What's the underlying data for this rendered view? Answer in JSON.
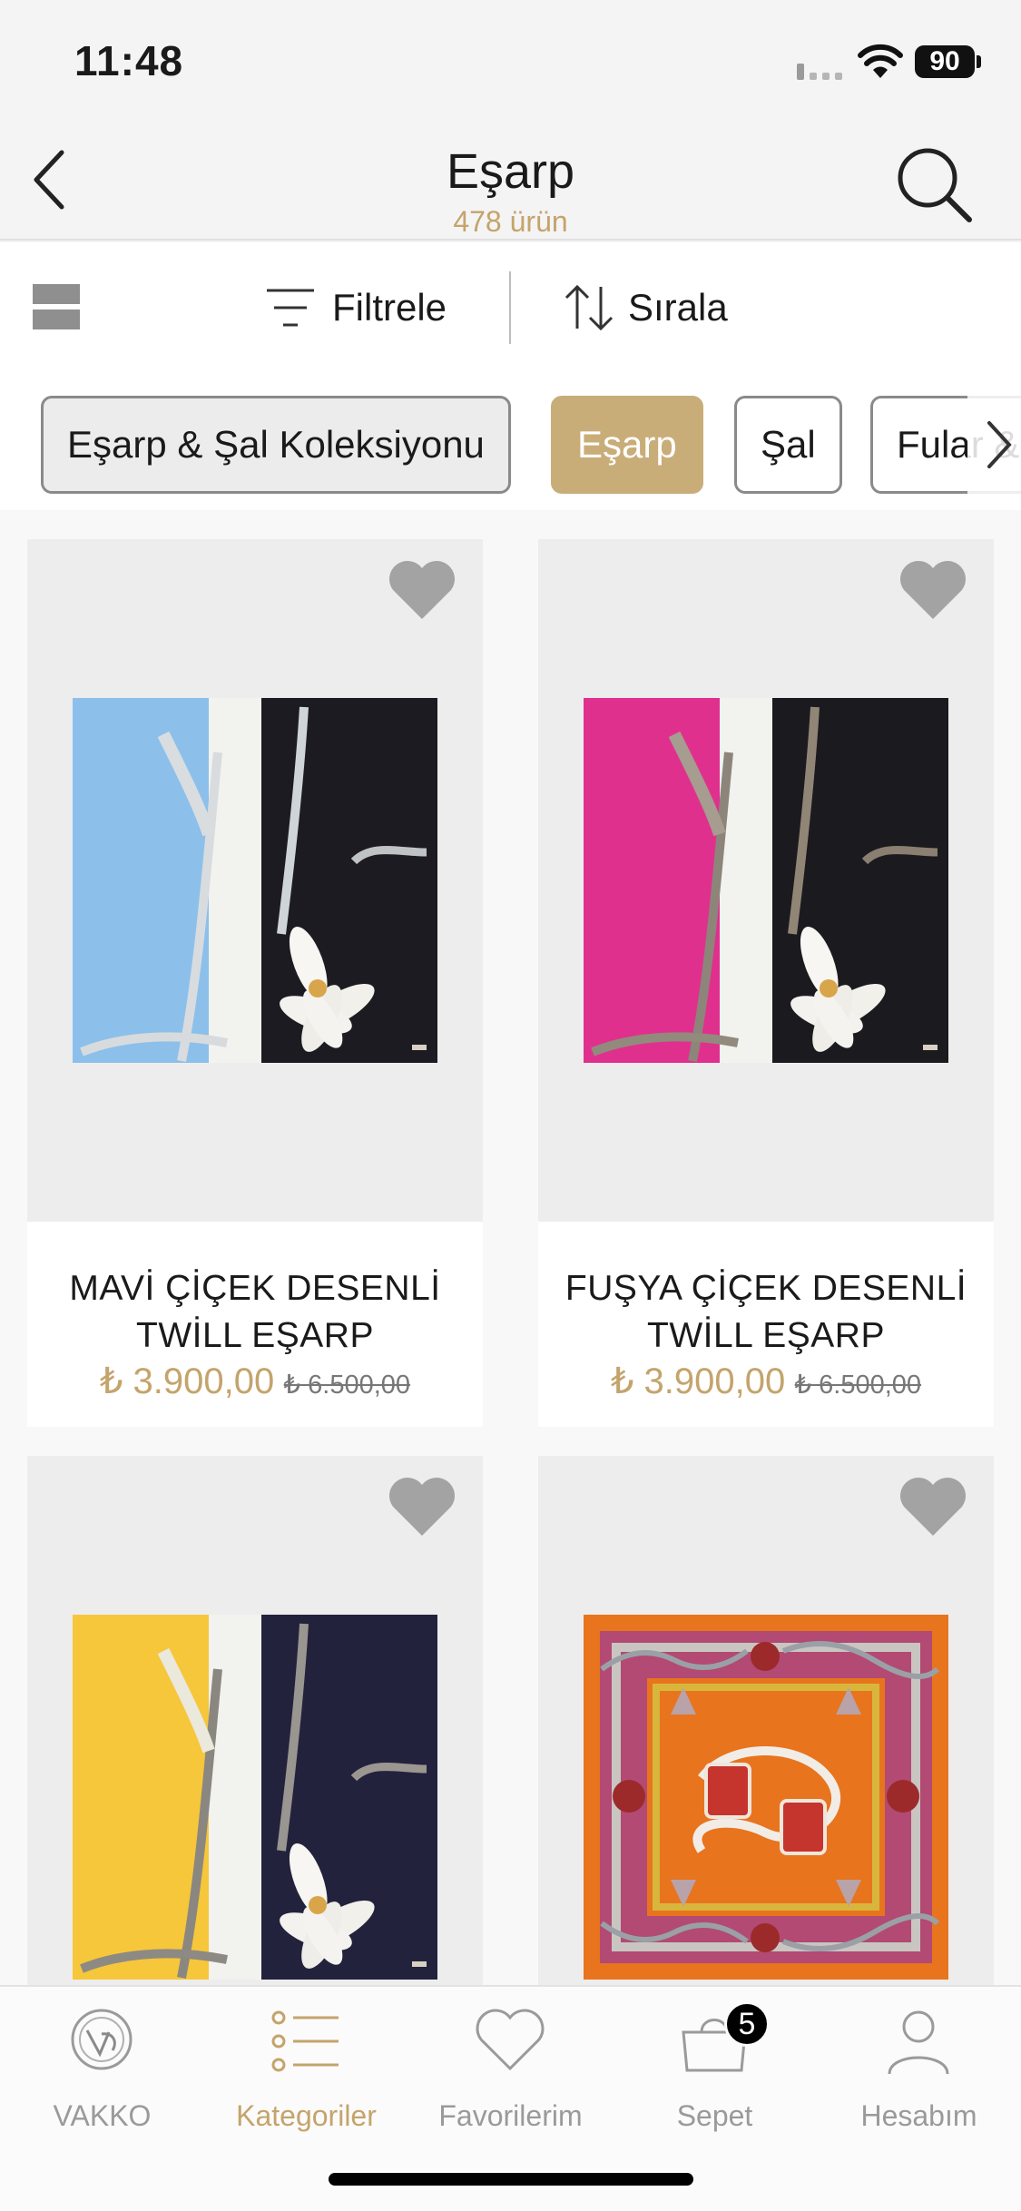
{
  "status": {
    "time": "11:48",
    "battery": "90"
  },
  "header": {
    "title": "Eşarp",
    "count": "478 ürün"
  },
  "toolbar": {
    "filter_label": "Filtrele",
    "sort_label": "Sırala"
  },
  "chips": [
    {
      "label": "Eşarp & Şal Koleksiyonu",
      "state": "secondary"
    },
    {
      "label": "Eşarp",
      "state": "active"
    },
    {
      "label": "Şal",
      "state": "default"
    },
    {
      "label": "Fular & ",
      "state": "default"
    }
  ],
  "products": [
    {
      "title_line1": "MAVİ ÇİÇEK DESENLİ",
      "title_line2": "TWİLL EŞARP",
      "price": "₺ 3.900,00",
      "old_price": "₺ 6.500,00",
      "colors": [
        "#8cc0ea",
        "#1c1b22"
      ]
    },
    {
      "title_line1": "FUŞYA ÇİÇEK DESENLİ",
      "title_line2": "TWİLL EŞARP",
      "price": "₺ 3.900,00",
      "old_price": "₺ 6.500,00",
      "colors": [
        "#e0308e",
        "#1b1a1f"
      ]
    },
    {
      "title_line1": "",
      "title_line2": "",
      "price": "",
      "old_price": "",
      "colors": [
        "#f6c63b",
        "#23223d"
      ]
    },
    {
      "title_line1": "",
      "title_line2": "",
      "price": "",
      "old_price": "",
      "colors": [
        "#e8741e",
        "#b24a73"
      ]
    }
  ],
  "tabs": [
    {
      "label": "VAKKO",
      "icon": "vakko-logo-icon"
    },
    {
      "label": "Kategoriler",
      "icon": "list-icon"
    },
    {
      "label": "Favorilerim",
      "icon": "heart-icon"
    },
    {
      "label": "Sepet",
      "icon": "bag-icon",
      "badge": "5"
    },
    {
      "label": "Hesabım",
      "icon": "user-icon"
    }
  ],
  "colors": {
    "accent": "#c4a46c",
    "chip_active": "#c9ad78"
  }
}
